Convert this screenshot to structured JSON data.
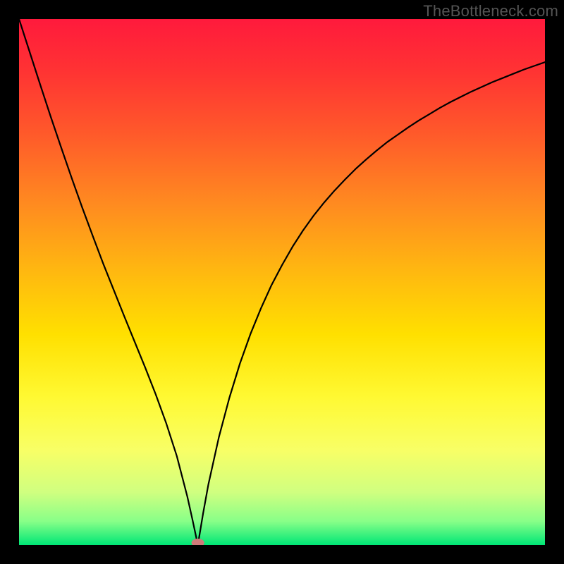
{
  "watermark": "TheBottleneck.com",
  "chart_data": {
    "type": "line",
    "title": "",
    "xlabel": "",
    "ylabel": "",
    "xlim": [
      0,
      1
    ],
    "ylim": [
      0,
      1
    ],
    "minimum_x": 0.34,
    "note": "V-shaped curve on rainbow gradient background; curve reaches minimum at x≈0.34.",
    "bg_gradient_stops": [
      {
        "offset": 0.0,
        "color": "#ff1a3c"
      },
      {
        "offset": 0.1,
        "color": "#ff3333"
      },
      {
        "offset": 0.22,
        "color": "#ff5a2a"
      },
      {
        "offset": 0.35,
        "color": "#ff8a20"
      },
      {
        "offset": 0.48,
        "color": "#ffb810"
      },
      {
        "offset": 0.6,
        "color": "#ffe000"
      },
      {
        "offset": 0.72,
        "color": "#fff933"
      },
      {
        "offset": 0.82,
        "color": "#f8ff66"
      },
      {
        "offset": 0.9,
        "color": "#d0ff80"
      },
      {
        "offset": 0.955,
        "color": "#88ff88"
      },
      {
        "offset": 1.0,
        "color": "#00e676"
      }
    ],
    "series": [
      {
        "name": "curve",
        "x": [
          0.0,
          0.02,
          0.04,
          0.06,
          0.08,
          0.1,
          0.12,
          0.14,
          0.16,
          0.18,
          0.2,
          0.22,
          0.24,
          0.26,
          0.28,
          0.3,
          0.32,
          0.33,
          0.34,
          0.35,
          0.36,
          0.38,
          0.4,
          0.42,
          0.44,
          0.46,
          0.48,
          0.5,
          0.52,
          0.54,
          0.56,
          0.58,
          0.6,
          0.62,
          0.64,
          0.66,
          0.68,
          0.7,
          0.72,
          0.74,
          0.76,
          0.78,
          0.8,
          0.82,
          0.84,
          0.86,
          0.88,
          0.9,
          0.92,
          0.94,
          0.96,
          0.98,
          1.0
        ],
        "y": [
          1.0,
          0.938,
          0.876,
          0.815,
          0.756,
          0.698,
          0.642,
          0.588,
          0.535,
          0.485,
          0.435,
          0.386,
          0.337,
          0.286,
          0.231,
          0.169,
          0.092,
          0.047,
          0.0,
          0.06,
          0.115,
          0.205,
          0.28,
          0.345,
          0.401,
          0.45,
          0.494,
          0.532,
          0.567,
          0.598,
          0.626,
          0.651,
          0.674,
          0.695,
          0.715,
          0.733,
          0.75,
          0.766,
          0.78,
          0.794,
          0.807,
          0.819,
          0.831,
          0.842,
          0.852,
          0.862,
          0.871,
          0.88,
          0.888,
          0.896,
          0.904,
          0.911,
          0.918
        ]
      }
    ],
    "marker": {
      "x": 0.34,
      "y": 0.0,
      "color": "#d07a7a"
    }
  }
}
